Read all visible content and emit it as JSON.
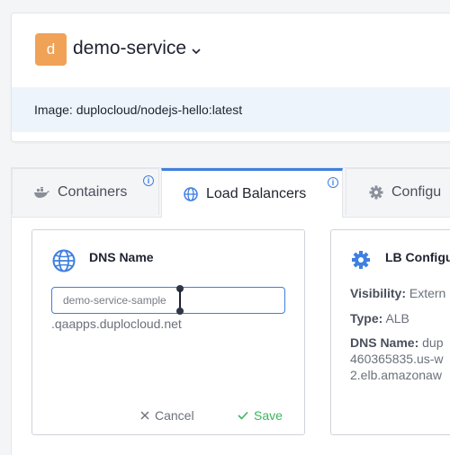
{
  "service": {
    "avatar_letter": "d",
    "name": "demo-service",
    "image_label": "Image: duplocloud/nodejs-hello:latest"
  },
  "tabs": [
    {
      "label": "Containers",
      "icon": "docker-icon",
      "active": false
    },
    {
      "label": "Load Balancers",
      "icon": "globe-icon",
      "active": true
    },
    {
      "label": "Configu",
      "icon": "gear-icon",
      "active": false
    }
  ],
  "dns_card": {
    "title": "DNS Name",
    "input_value": "demo-service-sample",
    "suffix": ".qaapps.duplocloud.net",
    "cancel_label": "Cancel",
    "save_label": "Save"
  },
  "lb_card": {
    "title": "LB Configu",
    "visibility_label": "Visibility:",
    "visibility_value": "Extern",
    "type_label": "Type:",
    "type_value": "ALB",
    "dns_label": "DNS Name:",
    "dns_value_1": "dup",
    "dns_value_2": "460365835.us-w",
    "dns_value_3": "2.elb.amazonaw"
  },
  "colors": {
    "accent": "#3f7fe0",
    "avatar": "#f0a257",
    "save": "#3bb55f",
    "banner": "#eef4fc"
  }
}
